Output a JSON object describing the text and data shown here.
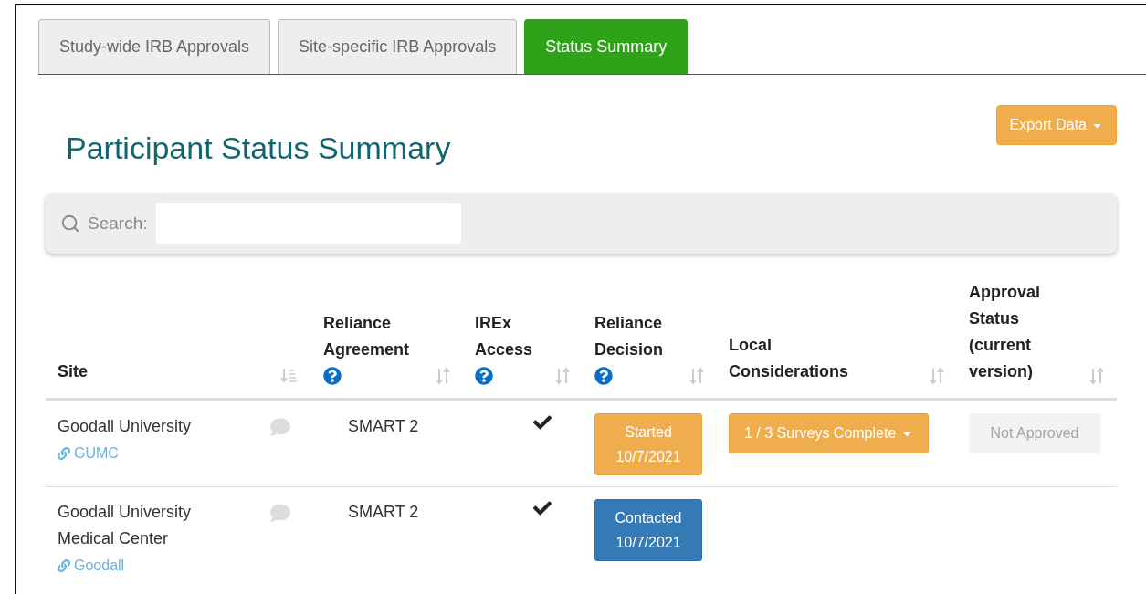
{
  "tabs": [
    {
      "label": "Study-wide IRB Approvals",
      "selected": false
    },
    {
      "label": "Site-specific IRB Approvals",
      "selected": false
    },
    {
      "label": "Status Summary",
      "selected": true
    }
  ],
  "export_button": {
    "label": "Export Data"
  },
  "heading": "Participant Status Summary",
  "search": {
    "label": "Search:"
  },
  "table": {
    "columns": [
      {
        "label": "Site",
        "help": false,
        "sorted": true
      },
      {
        "label": "Reliance Agreement",
        "help": true,
        "sorted": false
      },
      {
        "label": "IREx Access",
        "help": true,
        "sorted": false
      },
      {
        "label": "Reliance Decision",
        "help": true,
        "sorted": false
      },
      {
        "label": "Local Considerations",
        "help": false,
        "sorted": false
      },
      {
        "label": "Approval Status (current version)",
        "help": false,
        "sorted": false
      }
    ],
    "rows": [
      {
        "site": "Goodall University",
        "link": "GUMC",
        "agreement": "SMART 2",
        "irex_access": true,
        "decision": {
          "kind": "started",
          "status": "Started",
          "date": "10/7/2021"
        },
        "local": {
          "label": "1 / 3 Surveys Complete"
        },
        "approval": {
          "label": "Not Approved",
          "disabled": true
        }
      },
      {
        "site": "Goodall University Medical Center",
        "link": "Goodall",
        "agreement": "SMART 2",
        "irex_access": true,
        "decision": {
          "kind": "contacted",
          "status": "Contacted",
          "date": "10/7/2021"
        }
      }
    ]
  }
}
